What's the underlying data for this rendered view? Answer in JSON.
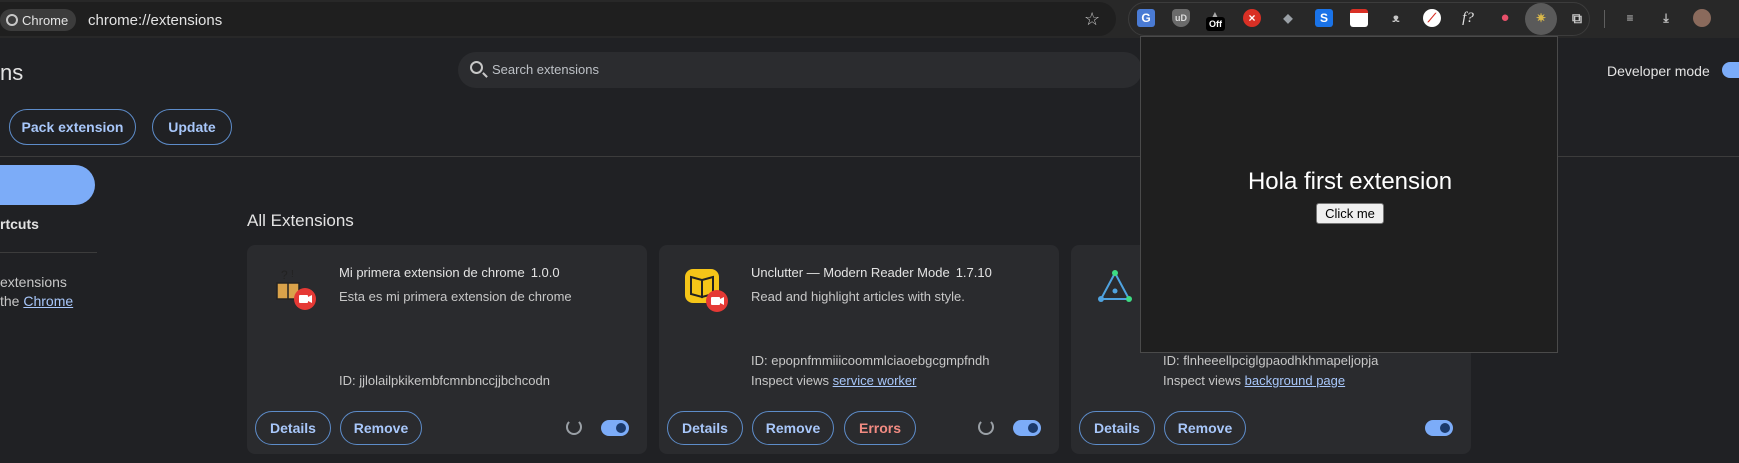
{
  "browser": {
    "chip_label": "Chrome",
    "url": "chrome://extensions",
    "toolbar_icons": [
      "translate-icon",
      "ublock-icon",
      "off-badge-icon",
      "blocker-x-icon",
      "shield-grey-icon",
      "s-blue-icon",
      "calendar-icon",
      "raccoon-icon",
      "colorful-leaf-icon",
      "formula-icon",
      "red-leaf-icon",
      "custom-ext-icon",
      "puzzle-icon",
      "media-list-icon",
      "download-icon",
      "profile-avatar"
    ],
    "off_badge": "Off",
    "formula_label": "f?"
  },
  "page": {
    "title": "ns",
    "search_placeholder": "Search extensions",
    "developer_mode_label": "Developer mode",
    "developer_mode_on": true,
    "pack_button": "Pack extension",
    "update_button": "Update",
    "sidebar": {
      "shortcuts": "rtcuts",
      "text_line1": "extensions",
      "text_line2_prefix": "the ",
      "text_line2_link": "Chrome"
    },
    "section_title": "All Extensions"
  },
  "cards": [
    {
      "name": "Mi primera extension de chrome",
      "version": "1.0.0",
      "description": "Esta es mi primera extension de chrome",
      "id": "ID: jjlolailpkikembfcmnbnccjjbchcodn",
      "details": "Details",
      "remove": "Remove",
      "enabled": true
    },
    {
      "name": "Unclutter — Modern Reader Mode",
      "version": "1.7.10",
      "description": "Read and highlight articles with style.",
      "id": "ID: epopnfmmiiicoommlciaoebgcgmpfndh",
      "inspect_prefix": "Inspect views ",
      "inspect_link": "service worker",
      "details": "Details",
      "remove": "Remove",
      "errors": "Errors",
      "enabled": true
    },
    {
      "id": "ID: flnheeellpciglgpaodhkhmapeljopja",
      "inspect_prefix": "Inspect views ",
      "inspect_link": "background page",
      "details": "Details",
      "remove": "Remove",
      "enabled": true
    }
  ],
  "popup": {
    "heading": "Hola first extension",
    "button": "Click me"
  },
  "colors": {
    "accent": "#a8c7fa",
    "toggle": "#7cacf8",
    "error": "#f28b82",
    "background": "#202124"
  }
}
